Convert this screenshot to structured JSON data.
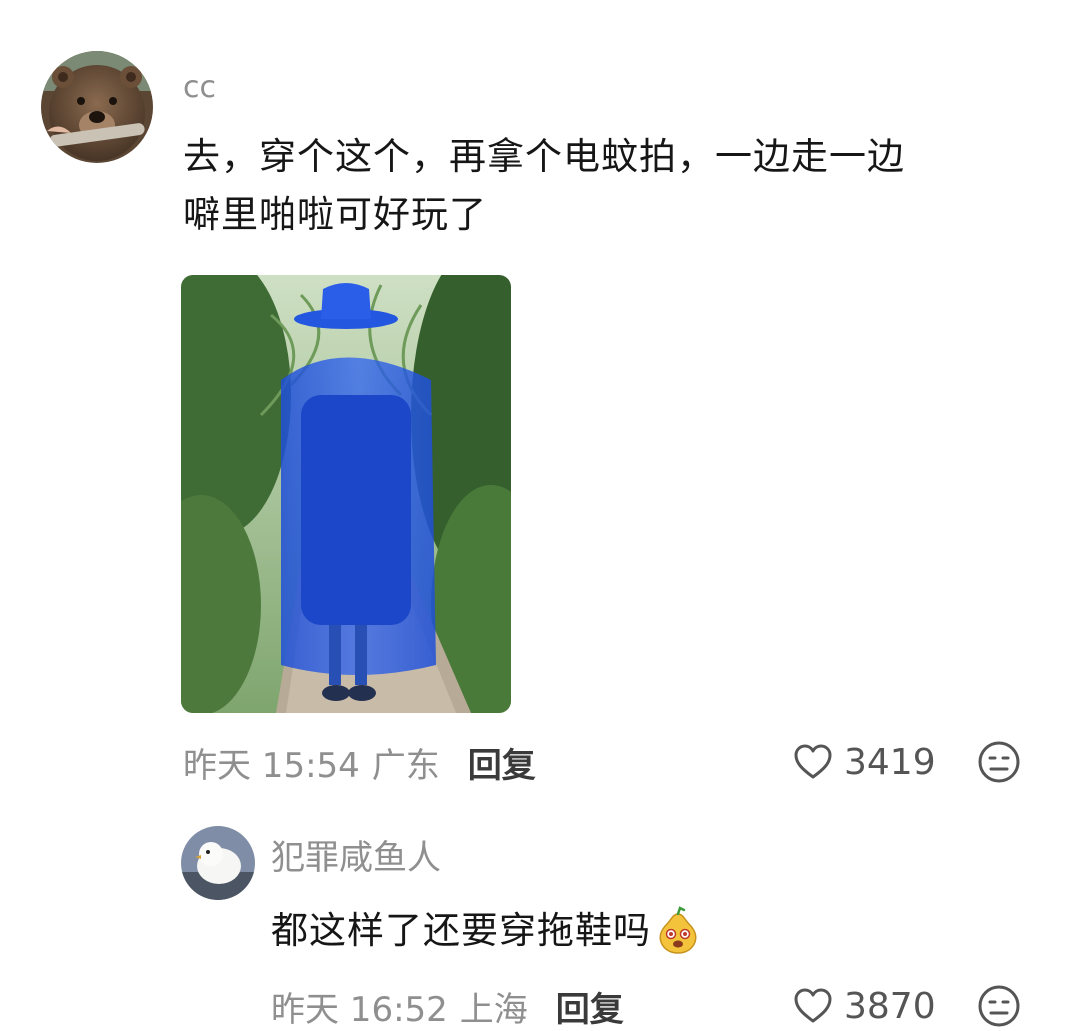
{
  "comments": [
    {
      "username": "cc",
      "avatar": "bear-avatar-icon",
      "text_line1": "去，穿个这个，再拿个电蚊拍，一边走一边",
      "text_line2": "噼里啪啦可好玩了",
      "image": "blue-mosquito-net-outfit-photo",
      "time": "昨天 15:54",
      "location": "广东",
      "reply_label": "回复",
      "likes": "3419",
      "colors": {
        "username": "#8f8f8f",
        "meta": "#8f8f8f",
        "text": "#161616"
      }
    },
    {
      "username": "犯罪咸鱼人",
      "avatar": "white-bird-avatar-icon",
      "text": "都这样了还要穿拖鞋吗",
      "emoji": "pear-face-emoji-icon",
      "time": "昨天 16:52",
      "location": "上海",
      "reply_label": "回复",
      "likes": "3870"
    }
  ]
}
